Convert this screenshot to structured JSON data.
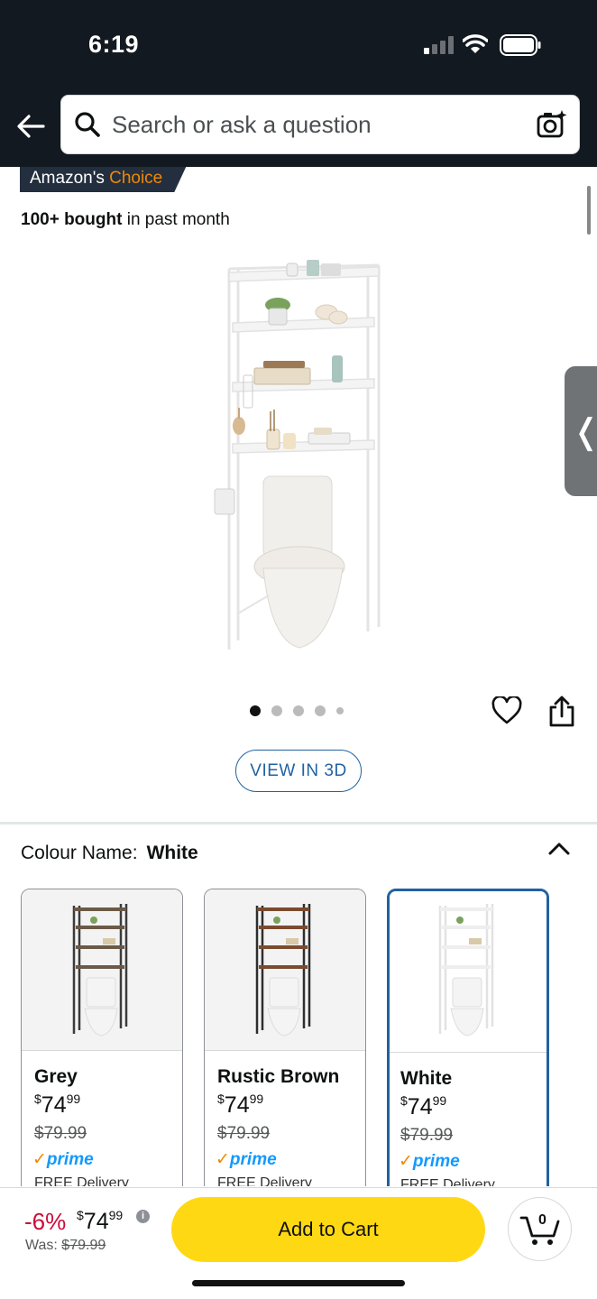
{
  "status_bar": {
    "time": "6:19"
  },
  "search": {
    "placeholder": "Search or ask a question"
  },
  "badge": {
    "prefix": "Amazon's ",
    "highlight": "Choice"
  },
  "bought": {
    "bold": "100+ bought",
    "rest": " in past month"
  },
  "gallery": {
    "view3d_label": "VIEW IN 3D",
    "image_count": 5,
    "active_index": 0
  },
  "colour": {
    "label": "Colour Name:",
    "value": "White"
  },
  "variants": [
    {
      "name": "Grey",
      "currency": "$",
      "price_whole": "74",
      "price_cents": "99",
      "was": "$79.99",
      "prime": "prime",
      "delivery": "FREE Delivery"
    },
    {
      "name": "Rustic Brown",
      "currency": "$",
      "price_whole": "74",
      "price_cents": "99",
      "was": "$79.99",
      "prime": "prime",
      "delivery": "FREE Delivery"
    },
    {
      "name": "White",
      "currency": "$",
      "price_whole": "74",
      "price_cents": "99",
      "was": "$79.99",
      "prime": "prime",
      "delivery": "FREE Delivery"
    }
  ],
  "buy_bar": {
    "discount": "-6%",
    "currency": "$",
    "price_whole": "74",
    "price_cents": "99",
    "was_label": "Was: ",
    "was_value": "$79.99",
    "add_to_cart": "Add to Cart",
    "cart_count": "0"
  },
  "colors": {
    "header_bg": "#131921",
    "cta_yellow": "#ffd814",
    "link_blue": "#2162a1",
    "deal_red": "#cc0c39",
    "prime_blue": "#1399ff"
  }
}
